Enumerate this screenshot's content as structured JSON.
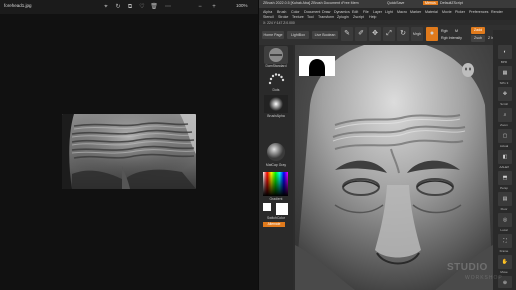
{
  "viewer": {
    "file_name": "forehead1.jpg",
    "zoom": "100%",
    "icons": [
      "cursor-icon",
      "rotate-icon",
      "crop-icon",
      "favorite-icon",
      "delete-icon",
      "more-icon",
      "zoom-out-icon",
      "zoom-in-icon"
    ]
  },
  "zbrush": {
    "title_parts": [
      "ZBrush 2022.0.5 [Kuhak Aba]",
      "ZBrush Document",
      "•Free Mem",
      "QuickSave",
      "Menus",
      "DefaultZScript"
    ],
    "menu_items": [
      "Alpha",
      "Brush",
      "Color",
      "Document",
      "Draw",
      "Dynamics",
      "Edit",
      "File",
      "Layer",
      "Light",
      "Macro",
      "Marker",
      "Material",
      "Movie",
      "Picker",
      "Preferences",
      "Render",
      "Stencil",
      "Stroke",
      "Texture",
      "Tool",
      "Transform",
      "Zplugin",
      "Zscript",
      "Help"
    ],
    "status": "X: 224  Y:147  Z:0.000",
    "shelf_buttons": [
      "Home Page",
      "LightBox",
      "Live Boolean"
    ],
    "tools": [
      "Edit",
      "Draw",
      "Move",
      "Scale",
      "Rotate"
    ],
    "mrgb": "Mrgb",
    "rgb": "Rgb",
    "m": "M",
    "zadd": "Zadd",
    "zsub": "Zsub",
    "rgb_intensity": "Rgb Intensity",
    "z_intensity": "Z Intensity",
    "brushes": [
      "DamStandard",
      "Dots",
      "BrushAlpha"
    ],
    "material": "MatCap Gray",
    "gradient": "Gradient",
    "switch_color": "SwitchColor",
    "alternate": "Alternate",
    "right_labels": [
      "BPR",
      "SPix 3",
      "Scroll",
      "Zoom",
      "Actual",
      "AAHalf",
      "Persp",
      "Floor",
      "Local",
      "Frame",
      "Move",
      "Zoom3D",
      "Rotate",
      "Line Fill",
      "Transp",
      "Solo",
      "Xpose"
    ],
    "watermark": "STUDIO",
    "watermark_sub": "WORKSHOP"
  }
}
